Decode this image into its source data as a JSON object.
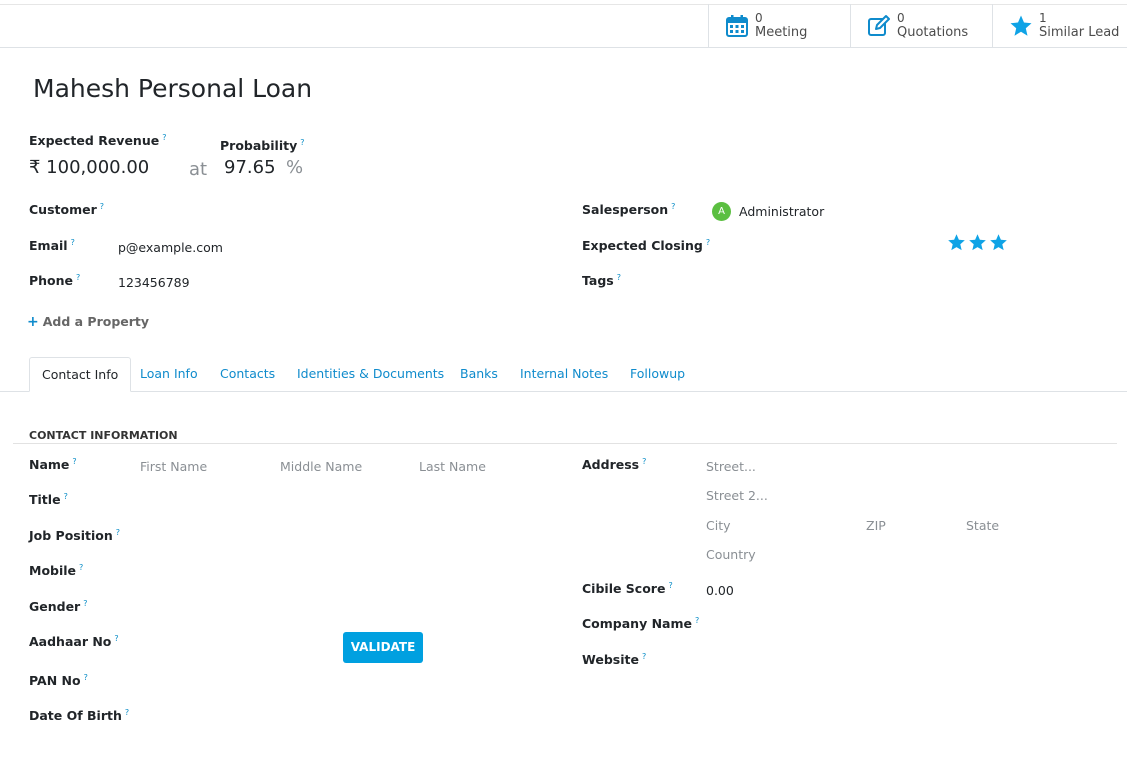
{
  "stat_buttons": [
    {
      "count": "0",
      "label": "Meeting",
      "icon": "calendar-icon"
    },
    {
      "count": "0",
      "label": "Quotations",
      "icon": "edit-icon"
    },
    {
      "count": "1",
      "label": "Similar Lead",
      "icon": "star-icon"
    }
  ],
  "record": {
    "title": "Mahesh Personal Loan"
  },
  "revenue": {
    "label": "Expected Revenue",
    "value": "₹ 100,000.00",
    "at": "at"
  },
  "probability": {
    "label": "Probability",
    "value": "97.65",
    "unit": "%"
  },
  "left_fields": {
    "customer_label": "Customer",
    "email_label": "Email",
    "email_value": "p@example.com",
    "phone_label": "Phone",
    "phone_value": "123456789"
  },
  "right_fields": {
    "salesperson_label": "Salesperson",
    "salesperson_initial": "A",
    "salesperson_value": "Administrator",
    "expected_closing_label": "Expected Closing",
    "tags_label": "Tags",
    "priority_stars": 3
  },
  "add_property": "Add a Property",
  "tabs": [
    {
      "label": "Contact Info",
      "active": true
    },
    {
      "label": "Loan Info"
    },
    {
      "label": "Contacts"
    },
    {
      "label": "Identities & Documents"
    },
    {
      "label": "Banks"
    },
    {
      "label": "Internal Notes"
    },
    {
      "label": "Followup"
    }
  ],
  "contact_section": {
    "title": "CONTACT INFORMATION",
    "name_label": "Name",
    "first_name_placeholder": "First Name",
    "middle_name_placeholder": "Middle Name",
    "last_name_placeholder": "Last Name",
    "title_label": "Title",
    "job_position_label": "Job Position",
    "mobile_label": "Mobile",
    "gender_label": "Gender",
    "aadhaar_label": "Aadhaar No",
    "validate_button": "VALIDATE",
    "pan_label": "PAN No",
    "dob_label": "Date Of Birth",
    "address_label": "Address",
    "street_placeholder": "Street...",
    "street2_placeholder": "Street 2...",
    "city_placeholder": "City",
    "zip_placeholder": "ZIP",
    "state_placeholder": "State",
    "country_placeholder": "Country",
    "cibile_label": "Cibile Score",
    "cibile_value": "0.00",
    "company_label": "Company Name",
    "website_label": "Website"
  },
  "help_mark": "?",
  "colors": {
    "accent": "#0f8bcc",
    "star": "#0fa3e6",
    "button": "#00a0e0",
    "avatar": "#5bbf41"
  }
}
